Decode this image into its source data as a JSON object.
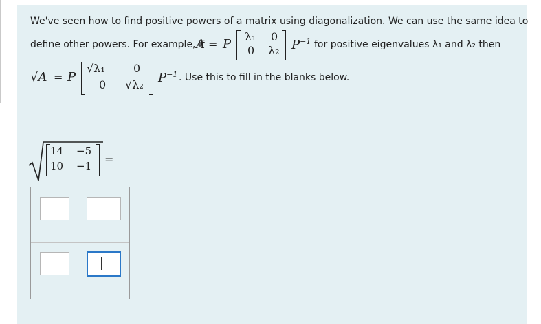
{
  "intro": {
    "line1": "We've seen how to find positive powers of a matrix using diagonalization. We can use the same idea to",
    "line2_prefix": "define other powers. For example, if",
    "A": "A",
    "eq": "=",
    "P": "P",
    "lambda1": "λ₁",
    "lambda2": "λ₂",
    "zero": "0",
    "pinv": "P",
    "pinv_exp": "−1",
    "line2_suffix": "for positive eigenvalues λ₁ and λ₂ then",
    "sqrtA": "√A",
    "sqrt_l1": "√λ₁",
    "sqrt_l2": "√λ₂",
    "line3_suffix": ". Use this to fill in the blanks below."
  },
  "question": {
    "matrix": [
      [
        "14",
        "−5"
      ],
      [
        "10",
        "−1"
      ]
    ],
    "equals": "="
  },
  "answer": {
    "inputs": [
      {
        "value": ""
      },
      {
        "value": ""
      },
      {
        "value": ""
      },
      {
        "value": ""
      }
    ]
  }
}
